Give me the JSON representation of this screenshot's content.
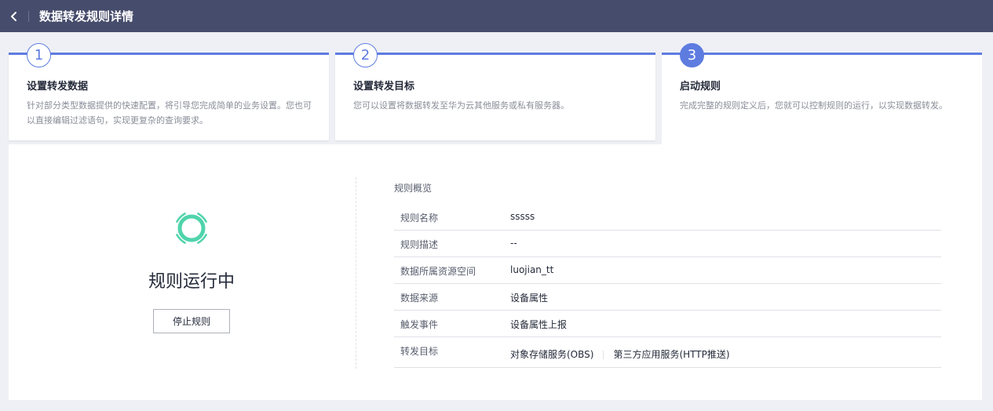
{
  "header": {
    "title": "数据转发规则详情",
    "back_icon": "chevron-left-icon"
  },
  "steps": [
    {
      "number": "1",
      "title": "设置转发数据",
      "desc": "针对部分类型数据提供的快速配置，将引导您完成简单的业务设置。您也可以直接编辑过滤语句，实现更复杂的查询要求。",
      "state": "done"
    },
    {
      "number": "2",
      "title": "设置转发目标",
      "desc": "您可以设置将数据转发至华为云其他服务或私有服务器。",
      "state": "done"
    },
    {
      "number": "3",
      "title": "启动规则",
      "desc": "完成完整的规则定义后，您就可以控制规则的运行，以实现数据转发。",
      "state": "active"
    }
  ],
  "status": {
    "text": "规则运行中",
    "stop_label": "停止规则",
    "icon": "running-spinner-icon",
    "color": "#50d4ab"
  },
  "overview": {
    "title": "规则概览",
    "rows": [
      {
        "label": "规则名称",
        "value": "sssss"
      },
      {
        "label": "规则描述",
        "value": "--"
      },
      {
        "label": "数据所属资源空间",
        "value": "luojian_tt"
      },
      {
        "label": "数据来源",
        "value": "设备属性"
      },
      {
        "label": "触发事件",
        "value": "设备属性上报"
      }
    ],
    "targets": {
      "label": "转发目标",
      "items": [
        "对象存储服务(OBS)",
        "第三方应用服务(HTTP推送)"
      ]
    }
  },
  "colors": {
    "brand": "#5e7ce0",
    "header_bg": "#464c6b",
    "page_bg": "#eff0f5"
  }
}
